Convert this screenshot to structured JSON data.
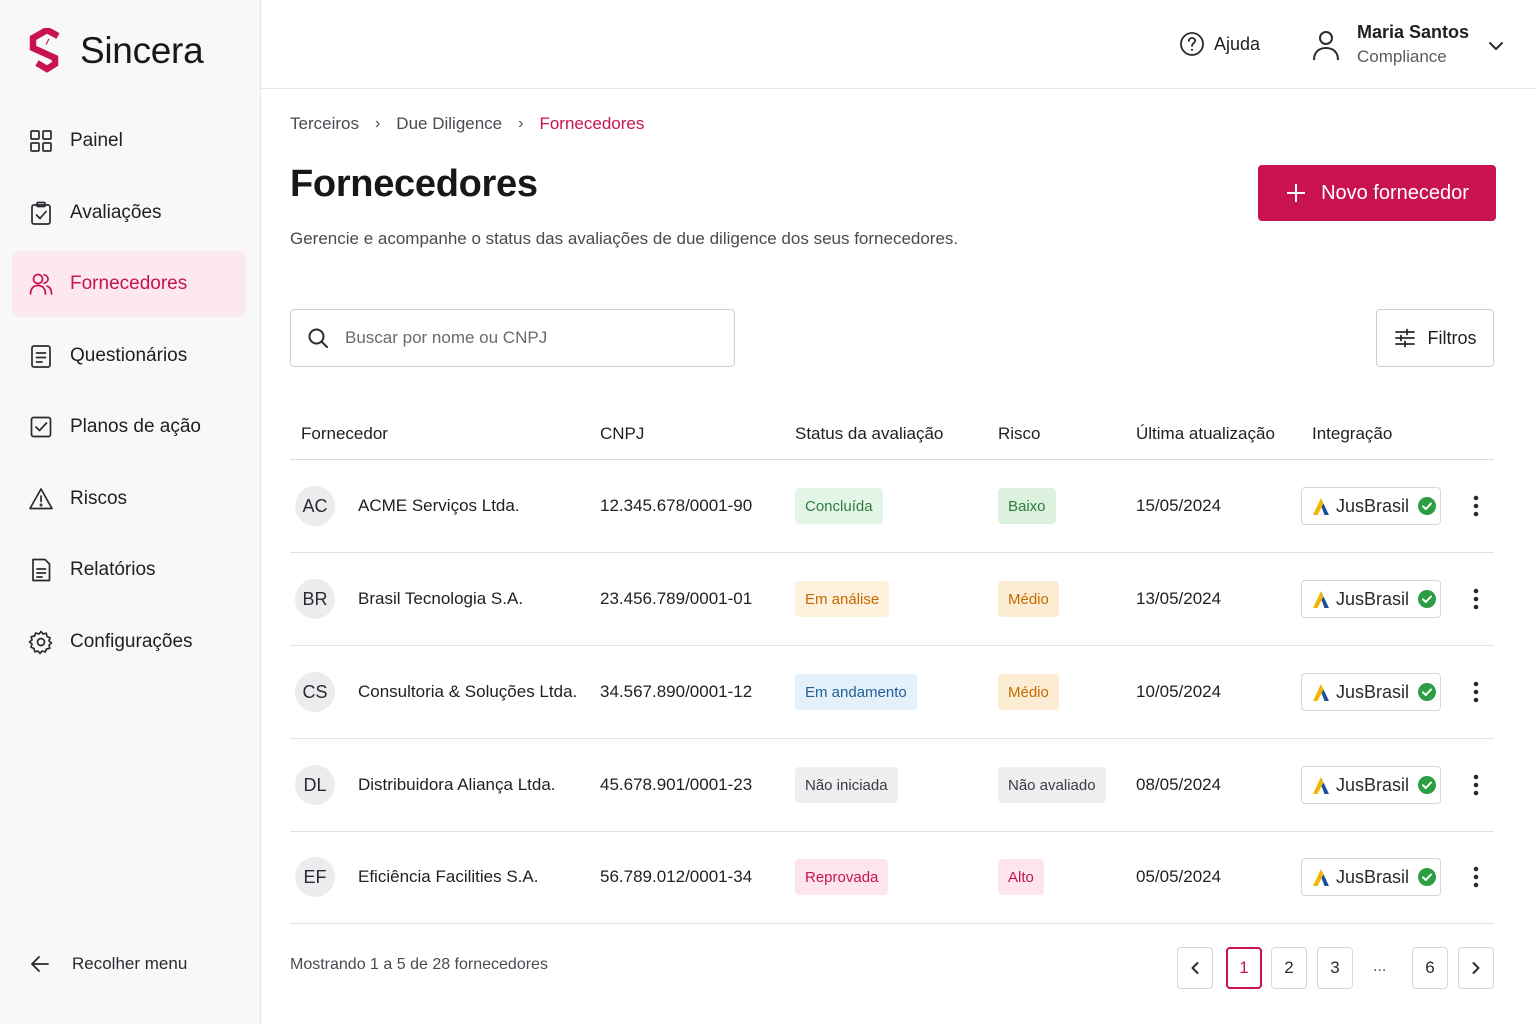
{
  "app": {
    "name": "Sincera"
  },
  "sidebar": {
    "items": [
      {
        "label": "Painel",
        "icon": "grid-icon"
      },
      {
        "label": "Avaliações",
        "icon": "clipboard-check-icon"
      },
      {
        "label": "Fornecedores",
        "icon": "users-icon",
        "active": true
      },
      {
        "label": "Questionários",
        "icon": "document-list-icon"
      },
      {
        "label": "Planos de ação",
        "icon": "checkbox-icon"
      },
      {
        "label": "Riscos",
        "icon": "warning-triangle-icon"
      },
      {
        "label": "Relatórios",
        "icon": "report-icon"
      },
      {
        "label": "Configurações",
        "icon": "gear-icon"
      }
    ],
    "collapse_label": "Recolher menu"
  },
  "header": {
    "help_label": "Ajuda",
    "user_name": "Maria Santos",
    "user_role": "Compliance"
  },
  "breadcrumb": [
    "Terceiros",
    "Due Diligence",
    "Fornecedores"
  ],
  "page": {
    "title": "Fornecedores",
    "subtitle": "Gerencie e acompanhe o status das avaliações de due diligence dos seus fornecedores.",
    "new_button": "Novo fornecedor",
    "search_placeholder": "Buscar por nome ou CNPJ",
    "filters_label": "Filtros"
  },
  "table": {
    "columns": [
      "Fornecedor",
      "CNPJ",
      "Status da avaliação",
      "Risco",
      "Última atualização",
      "Integração"
    ],
    "rows": [
      {
        "initials": "AC",
        "name": "ACME Serviços Ltda.",
        "cnpj": "12.345.678/0001-90",
        "status": "Concluída",
        "status_color": "#e3f5e6",
        "status_text": "#2e7d3e",
        "risk": "Baixo",
        "risk_color": "#dcf1de",
        "risk_text": "#2e7d3e",
        "updated": "15/05/2024",
        "integration": "JusBrasil"
      },
      {
        "initials": "BR",
        "name": "Brasil Tecnologia S.A.",
        "cnpj": "23.456.789/0001-01",
        "status": "Em análise",
        "status_color": "#fdf0dc",
        "status_text": "#c46a00",
        "risk": "Médio",
        "risk_color": "#fdecd4",
        "risk_text": "#c46a00",
        "updated": "13/05/2024",
        "integration": "JusBrasil"
      },
      {
        "initials": "CS",
        "name": "Consultoria & Soluções Ltda.",
        "cnpj": "34.567.890/0001-12",
        "status": "Em andamento",
        "status_color": "#e4f1fb",
        "status_text": "#1f5f99",
        "risk": "Médio",
        "risk_color": "#fdecd4",
        "risk_text": "#c46a00",
        "updated": "10/05/2024",
        "integration": "JusBrasil"
      },
      {
        "initials": "DL",
        "name": "Distribuidora Aliança Ltda.",
        "cnpj": "45.678.901/0001-23",
        "status": "Não iniciada",
        "status_color": "#efeff1",
        "status_text": "#3a3a40",
        "risk": "Não avaliado",
        "risk_color": "#efeff1",
        "risk_text": "#3a3a40",
        "updated": "08/05/2024",
        "integration": "JusBrasil"
      },
      {
        "initials": "EF",
        "name": "Eficiência Facilities S.A.",
        "cnpj": "56.789.012/0001-34",
        "status": "Reprovada",
        "status_color": "#fce6ec",
        "status_text": "#c8134f",
        "risk": "Alto",
        "risk_color": "#fce6ec",
        "risk_text": "#c8134f",
        "updated": "05/05/2024",
        "integration": "JusBrasil"
      }
    ]
  },
  "pagination": {
    "summary": "Mostrando 1 a 5 de 28 fornecedores",
    "pages": [
      "1",
      "2",
      "3",
      "...",
      "6"
    ],
    "current": "1"
  },
  "colors": {
    "accent": "#c8134f",
    "accent_soft": "#fce8ee",
    "success": "#2e9e44"
  }
}
